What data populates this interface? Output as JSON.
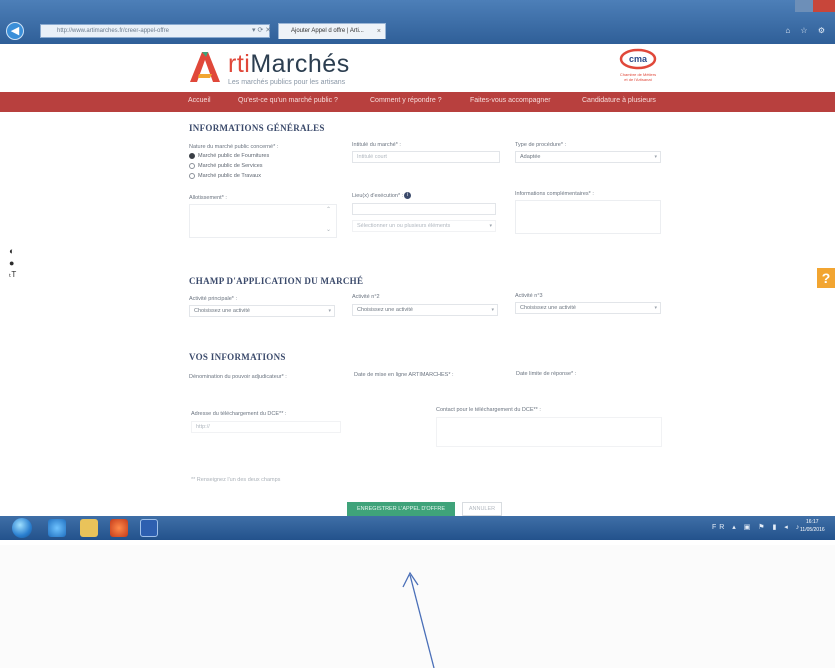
{
  "browser": {
    "address": "http://www.artimarches.fr/creer-appel-offre",
    "tab_title": "Ajouter Appel d offre | Arti..."
  },
  "site": {
    "logo_letter": "A",
    "logo_rest_1": "rti",
    "logo_rest_2": "Marchés",
    "tagline": "Les marchés publics pour les artisans",
    "partner_line1": "Chambre de Métiers",
    "partner_line2": "et de l'Artisanat"
  },
  "nav": {
    "items": [
      "Accueil",
      "Qu'est-ce qu'un marché public ?",
      "Comment y répondre ?",
      "Faites-vous accompagner",
      "Candidature à plusieurs"
    ]
  },
  "section1": {
    "title": "INFORMATIONS GÉNÉRALES",
    "nature_label": "Nature du marché public concerné* :",
    "radios": [
      {
        "label": "Marché public de Fournitures",
        "checked": true
      },
      {
        "label": "Marché public de Services",
        "checked": false
      },
      {
        "label": "Marché public de Travaux",
        "checked": false
      }
    ],
    "intitule_label": "Intitulé du marché* :",
    "intitule_placeholder": "Intitulé court",
    "procedure_label": "Type de procédure* :",
    "procedure_value": "Adaptée",
    "allotissement_label": "Allotissement* :",
    "lieux_label": "Lieu(x) d'exécution* :",
    "lieux_placeholder": "Sélectionner un ou plusieurs éléments",
    "infos_label": "Informations complémentaires* :"
  },
  "section2": {
    "title": "CHAMP D'APPLICATION DU MARCHÉ",
    "fields": [
      {
        "label": "Activité principale* :",
        "value": "Choisissez une activité"
      },
      {
        "label": "Activité n°2",
        "value": "Choisissez une activité"
      },
      {
        "label": "Activité n°3",
        "value": "Choisissez une activité"
      }
    ]
  },
  "section3": {
    "title": "VOS INFORMATIONS",
    "denomination_label": "Dénomination du pouvoir adjudicateur* :",
    "date_mise_label": "Date de mise en ligne ARTIMARCHES* :",
    "date_limite_label": "Date limite de réponse* :",
    "adresse_label": "Adresse du téléchargement du DCE** :",
    "adresse_placeholder": "http://",
    "contact_label": "Contact pour le téléchargement du DCE** :",
    "note": "** Renseignez l'un des deux champs"
  },
  "buttons": {
    "submit": "ENREGISTRER L'APPEL D'OFFRE",
    "cancel": "ANNULER"
  },
  "help": "?",
  "clock": {
    "time": "16:17",
    "date": "11/05/2016"
  },
  "colors": {
    "nav": "#b8403e",
    "submit": "#3fa37a",
    "help": "#f2a531",
    "taskbar": "#2f5f98"
  }
}
